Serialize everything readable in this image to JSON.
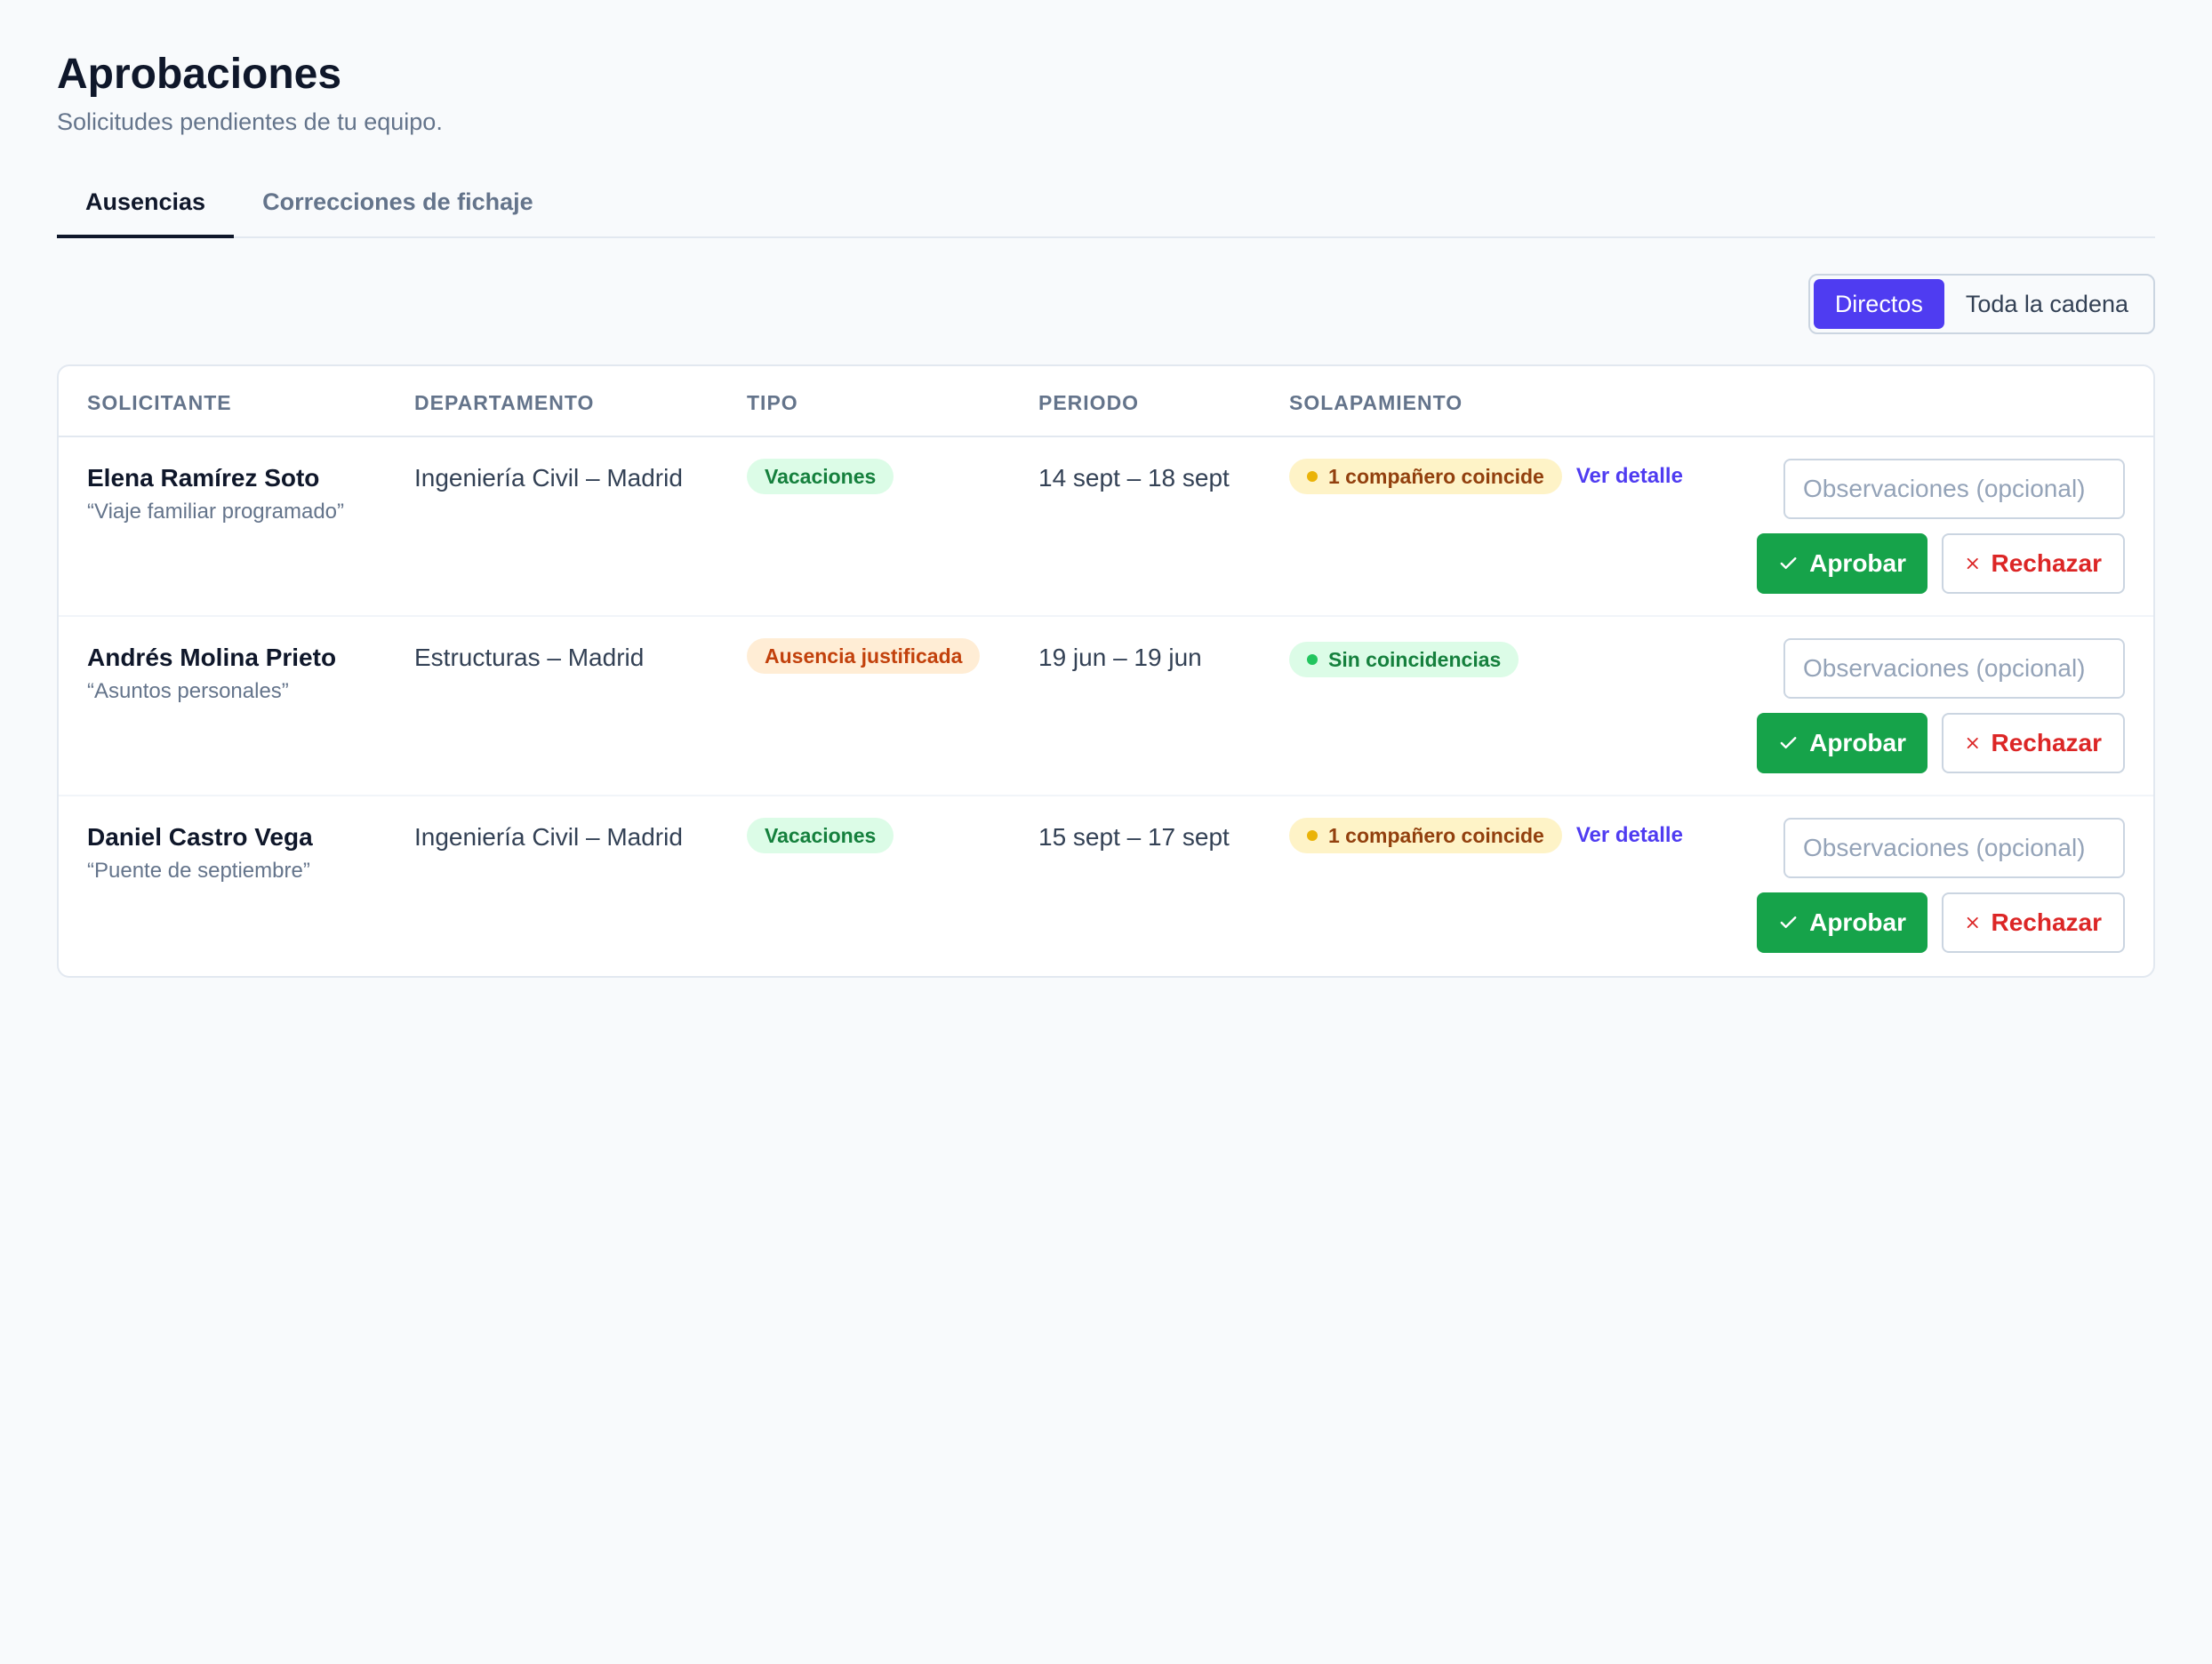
{
  "header": {
    "title": "Aprobaciones",
    "subtitle": "Solicitudes pendientes de tu equipo."
  },
  "tabs": [
    {
      "label": "Ausencias",
      "active": true
    },
    {
      "label": "Correcciones de fichaje",
      "active": false
    }
  ],
  "scope_toggle": {
    "options": [
      "Directos",
      "Toda la cadena"
    ],
    "selected": "Directos"
  },
  "table": {
    "columns": [
      "SOLICITANTE",
      "DEPARTAMENTO",
      "TIPO",
      "PERIODO",
      "SOLAPAMIENTO"
    ],
    "rows": [
      {
        "name": "Elena Ramírez Soto",
        "note": "“Viaje familiar programado”",
        "department": "Ingeniería Civil – Madrid",
        "type": "Vacaciones",
        "period": "14 sept – 18 sept",
        "overlap": "1 compañero coincide",
        "overlap_link": "Ver detalle"
      },
      {
        "name": "Andrés Molina Prieto",
        "note": "“Asuntos personales”",
        "department": "Estructuras – Madrid",
        "type": "Ausencia justificada",
        "period": "19 jun – 19 jun",
        "overlap": "Sin coincidencias",
        "overlap_link": ""
      },
      {
        "name": "Daniel Castro Vega",
        "note": "“Puente de septiembre”",
        "department": "Ingeniería Civil – Madrid",
        "type": "Vacaciones",
        "period": "15 sept – 17 sept",
        "overlap": "1 compañero coincide",
        "overlap_link": "Ver detalle"
      }
    ]
  },
  "actions": {
    "observations_placeholder": "Observaciones (opcional)",
    "approve_label": "Aprobar",
    "reject_label": "Rechazar",
    "approve_icon": "check-icon",
    "reject_icon": "x-icon"
  },
  "colors": {
    "accent": "#4f3cf1",
    "approve": "#16a34a",
    "reject": "#dc2626"
  }
}
